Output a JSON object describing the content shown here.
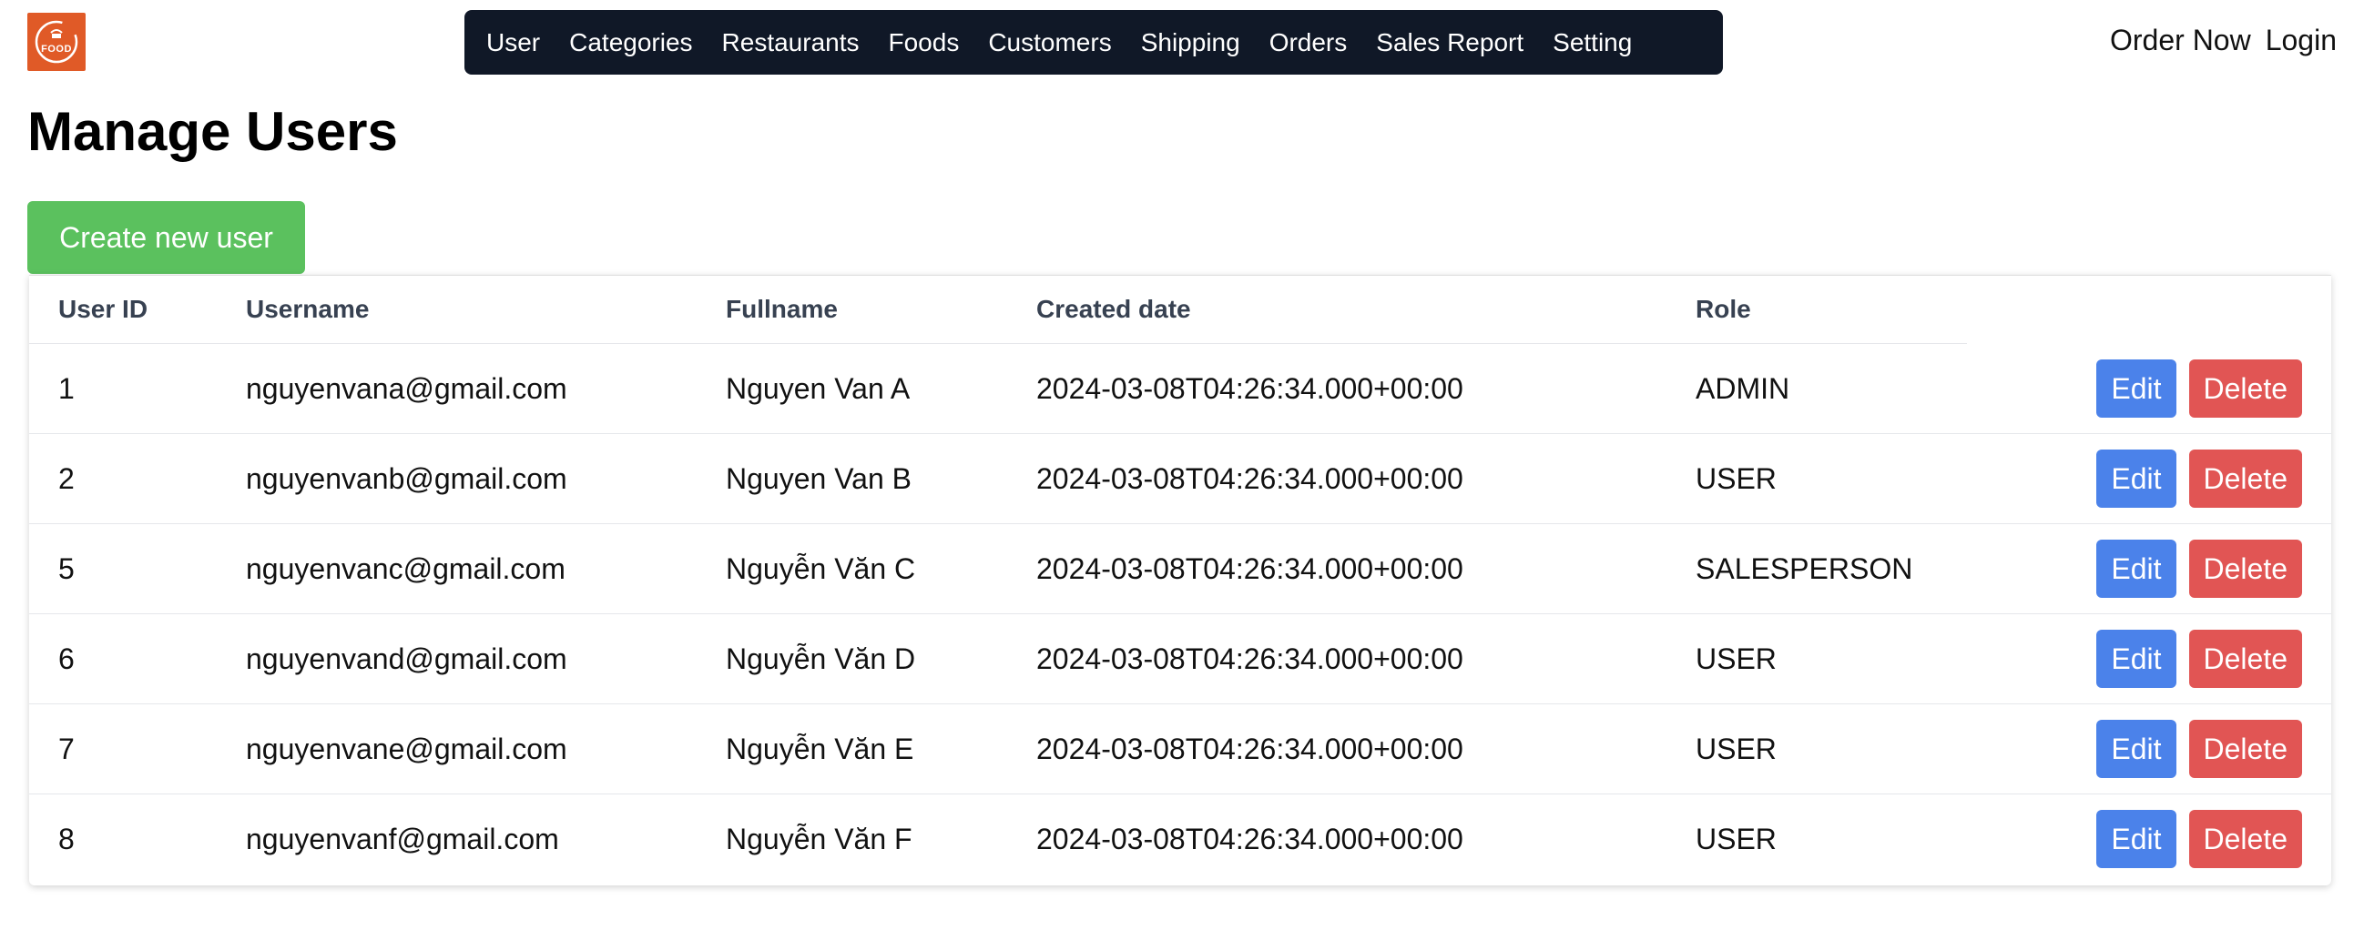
{
  "brand": {
    "logo_text": "FOOD"
  },
  "nav": {
    "items": [
      "User",
      "Categories",
      "Restaurants",
      "Foods",
      "Customers",
      "Shipping",
      "Orders",
      "Sales Report",
      "Setting"
    ]
  },
  "top_right": {
    "order_now": "Order Now",
    "login": "Login"
  },
  "page": {
    "title": "Manage Users",
    "create_button": "Create new user"
  },
  "table": {
    "headers": {
      "id": "User ID",
      "username": "Username",
      "fullname": "Fullname",
      "created": "Created date",
      "role": "Role"
    },
    "edit_label": "Edit",
    "delete_label": "Delete",
    "rows": [
      {
        "id": "1",
        "username": "nguyenvana@gmail.com",
        "fullname": "Nguyen Van A",
        "created": "2024-03-08T04:26:34.000+00:00",
        "role": "ADMIN"
      },
      {
        "id": "2",
        "username": "nguyenvanb@gmail.com",
        "fullname": "Nguyen Van B",
        "created": "2024-03-08T04:26:34.000+00:00",
        "role": "USER"
      },
      {
        "id": "5",
        "username": "nguyenvanc@gmail.com",
        "fullname": "Nguyễn Văn C",
        "created": "2024-03-08T04:26:34.000+00:00",
        "role": "SALESPERSON"
      },
      {
        "id": "6",
        "username": "nguyenvand@gmail.com",
        "fullname": "Nguyễn Văn D",
        "created": "2024-03-08T04:26:34.000+00:00",
        "role": "USER"
      },
      {
        "id": "7",
        "username": "nguyenvane@gmail.com",
        "fullname": "Nguyễn Văn E",
        "created": "2024-03-08T04:26:34.000+00:00",
        "role": "USER"
      },
      {
        "id": "8",
        "username": "nguyenvanf@gmail.com",
        "fullname": "Nguyễn Văn F",
        "created": "2024-03-08T04:26:34.000+00:00",
        "role": "USER"
      }
    ]
  },
  "colors": {
    "navbar_bg": "#101827",
    "create_button": "#5bc15e",
    "edit_button": "#4b82ea",
    "delete_button": "#e15554",
    "logo_bg": "#e05a27"
  }
}
